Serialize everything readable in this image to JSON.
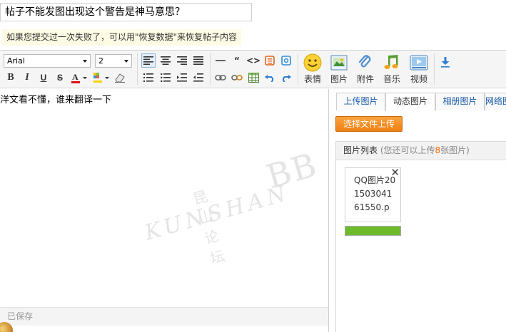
{
  "post": {
    "title": "帖子不能发图出现这个警告是神马意思？",
    "restore_tip": "如果您提交过一次失败了，可以用\"恢复数据\"来恢复帖子内容"
  },
  "toolbar": {
    "font_family": "Arial",
    "font_size": "2",
    "big_buttons": [
      "表情",
      "图片",
      "附件",
      "音乐",
      "视频"
    ]
  },
  "editor": {
    "content": "洋文看不懂，谁来翻译一下",
    "watermark_cn": "昆山论坛",
    "watermark_en": "KUNSHAN",
    "watermark_bb": "BB",
    "status": "已保存"
  },
  "image_panel": {
    "tabs": [
      "上传图片",
      "动态图片",
      "相册图片",
      "网络图片"
    ],
    "active_tab": 1,
    "upload_button": "选择文件上传",
    "list_title": "图片列表",
    "list_hint_prefix": "(您还可以上传",
    "list_hint_count": "8",
    "list_hint_suffix": "张图片)",
    "file": {
      "name": "QQ图片20150304161550.p",
      "progress": 1.0
    }
  },
  "colors": {
    "upload_orange": "#ee7f12",
    "progress_green": "#6dbb2a",
    "link_blue": "#1a5aa6"
  }
}
